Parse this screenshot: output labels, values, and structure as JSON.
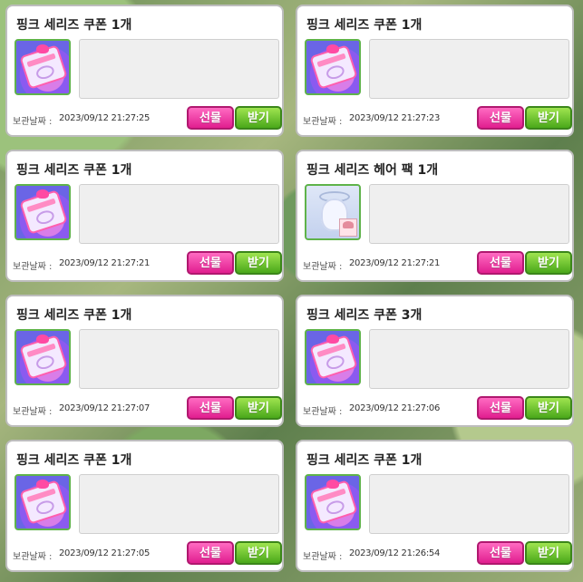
{
  "ui": {
    "date_label": "보관날짜 :",
    "gift_label": "선물",
    "receive_label": "받기"
  },
  "items": [
    {
      "title": "핑크 세리즈 쿠폰 1개",
      "icon": "pink-series-coupon-icon",
      "date": "2023/09/12 21:27:25"
    },
    {
      "title": "핑크 세리즈 쿠폰 1개",
      "icon": "pink-series-coupon-icon",
      "date": "2023/09/12 21:27:23"
    },
    {
      "title": "핑크 세리즈 쿠폰 1개",
      "icon": "pink-series-coupon-icon",
      "date": "2023/09/12 21:27:21"
    },
    {
      "title": "핑크 세리즈 헤어 팩 1개",
      "icon": "pink-series-hair-pack-icon",
      "date": "2023/09/12 21:27:21"
    },
    {
      "title": "핑크 세리즈 쿠폰 1개",
      "icon": "pink-series-coupon-icon",
      "date": "2023/09/12 21:27:07"
    },
    {
      "title": "핑크 세리즈 쿠폰 3개",
      "icon": "pink-series-coupon-icon",
      "date": "2023/09/12 21:27:06"
    },
    {
      "title": "핑크 세리즈 쿠폰 1개",
      "icon": "pink-series-coupon-icon",
      "date": "2023/09/12 21:27:05"
    },
    {
      "title": "핑크 세리즈 쿠폰 1개",
      "icon": "pink-series-coupon-icon",
      "date": "2023/09/12 21:26:54"
    }
  ],
  "colors": {
    "gift_button": "#e11e8f",
    "receive_button": "#4aa81a",
    "icon_border": "#5fb34a"
  }
}
